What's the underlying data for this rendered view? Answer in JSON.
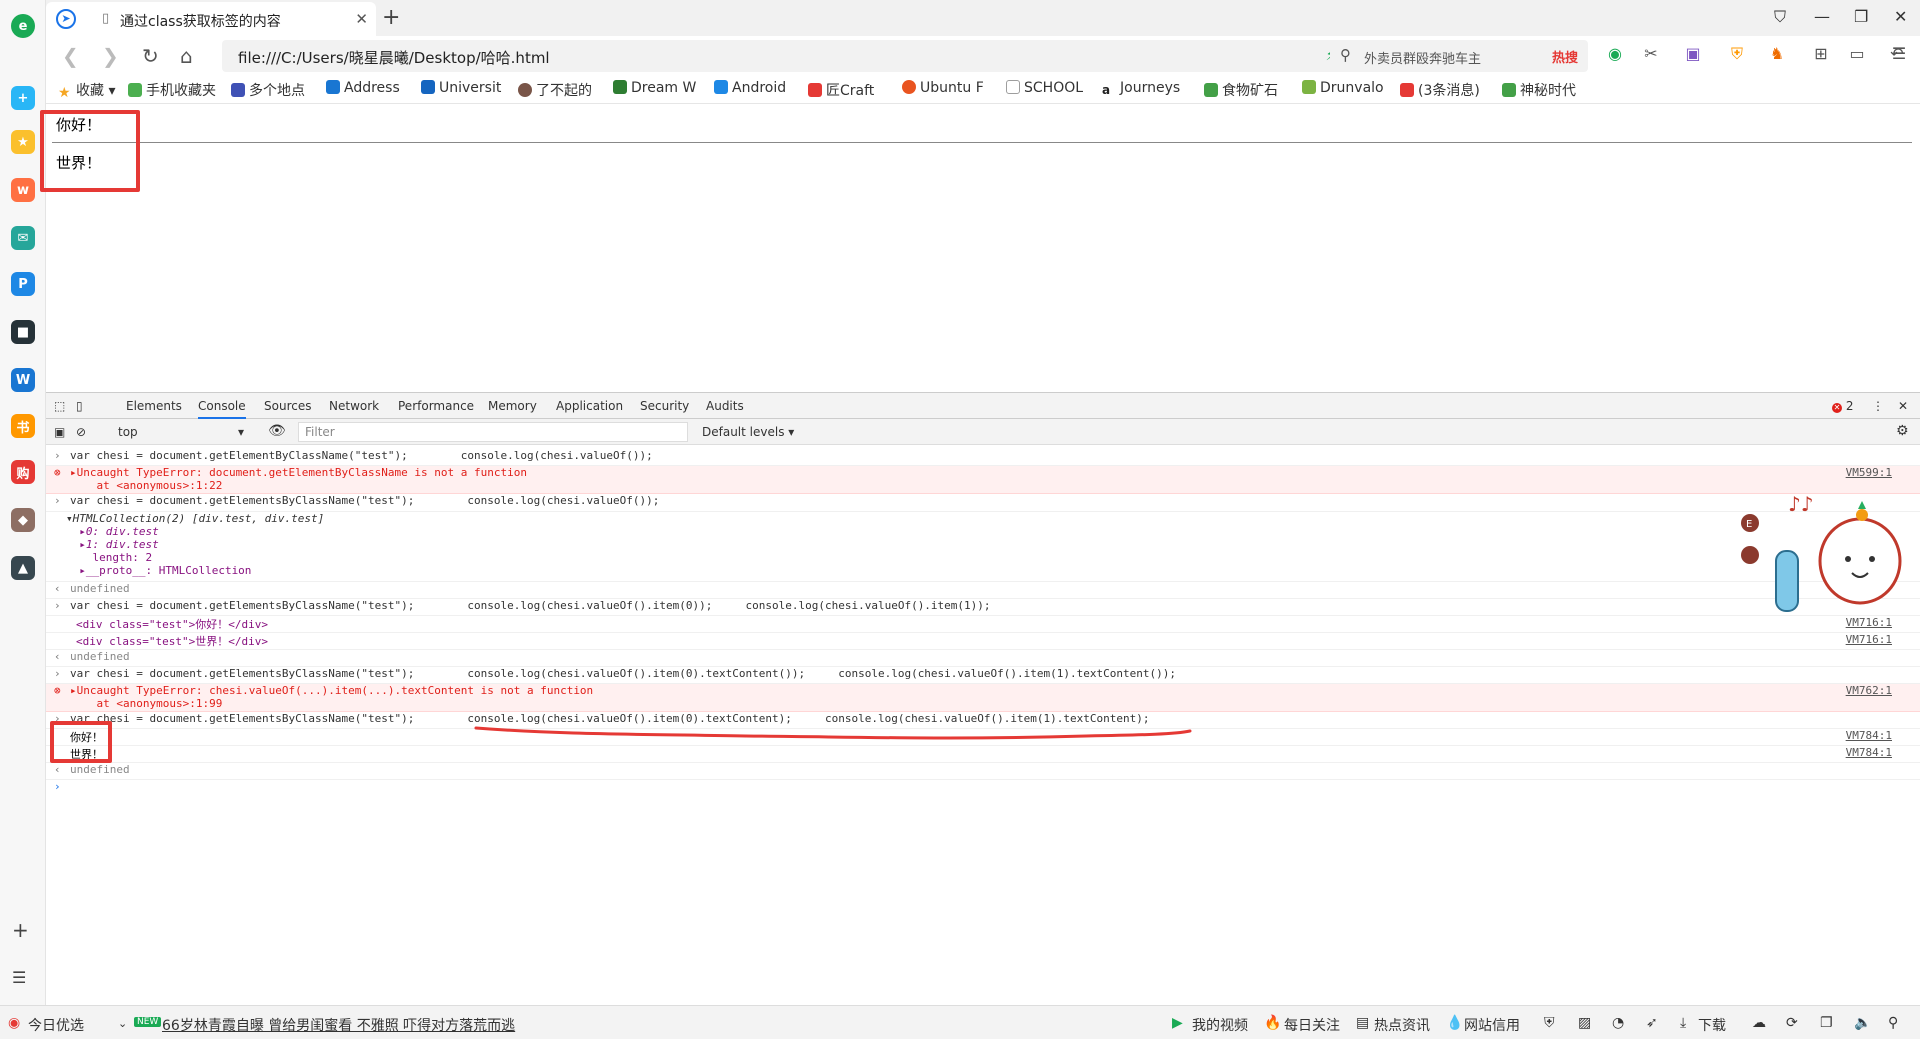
{
  "browser": {
    "tab_title": "通过class获取标签的内容",
    "url": "file:///C:/Users/晓星晨曦/Desktop/哈哈.html",
    "search_placeholder": "外卖员群殴奔驰车主",
    "search_badge": "热搜"
  },
  "bookmarks": [
    {
      "label": "收藏",
      "icon": "star-icon",
      "color": "#f5a623"
    },
    {
      "label": "手机收藏夹",
      "icon": "phone-icon",
      "color": "#4caf50"
    },
    {
      "label": "多个地点",
      "icon": "map-icon",
      "color": "#3f51b5"
    },
    {
      "label": "Address",
      "icon": "address-icon",
      "color": "#1976d2"
    },
    {
      "label": "Universit",
      "icon": "university-icon",
      "color": "#1565c0"
    },
    {
      "label": "了不起的",
      "icon": "gatsby-icon",
      "color": "#795548"
    },
    {
      "label": "Dream W",
      "icon": "dream-icon",
      "color": "#2e7d32"
    },
    {
      "label": "Android",
      "icon": "android-icon",
      "color": "#1e88e5"
    },
    {
      "label": "匠Craft",
      "icon": "craft-icon",
      "color": "#e53935"
    },
    {
      "label": "Ubuntu F",
      "icon": "ubuntu-icon",
      "color": "#e95420"
    },
    {
      "label": "SCHOOL",
      "icon": "page-icon",
      "color": "#9e9e9e"
    },
    {
      "label": "Journeys",
      "icon": "amazon-icon",
      "color": "#222222"
    },
    {
      "label": "食物矿石",
      "icon": "mc-icon",
      "color": "#43a047"
    },
    {
      "label": "Drunvalo",
      "icon": "leaf-icon",
      "color": "#7cb342"
    },
    {
      "label": "(3条消息)",
      "icon": "csdn-icon",
      "color": "#e53935"
    },
    {
      "label": "神秘时代",
      "icon": "mc-icon",
      "color": "#43a047"
    }
  ],
  "page": {
    "line1": "你好！",
    "line2": "世界！"
  },
  "devtools": {
    "tabs": [
      "Elements",
      "Console",
      "Sources",
      "Network",
      "Performance",
      "Memory",
      "Application",
      "Security",
      "Audits"
    ],
    "active_tab": "Console",
    "error_count": "2",
    "context": "top",
    "filter_placeholder": "Filter",
    "levels": "Default levels ▾"
  },
  "console": {
    "r1": "var chesi = document.getElementByClassName(\"test\");        console.log(chesi.valueOf());",
    "r2a": "▸Uncaught TypeError: document.getElementByClassName is not a function",
    "r2b": "    at <anonymous>:1:22",
    "r2src": "VM599:1",
    "r3": "var chesi = document.getElementsByClassName(\"test\");        console.log(chesi.valueOf());",
    "r4a": "▾HTMLCollection(2) [div.test, div.test]",
    "r4b": "  ▸0: div.test",
    "r4c": "  ▸1: div.test",
    "r4d": "    length: 2",
    "r4e": "  ▸__proto__: HTMLCollection",
    "undef": "undefined",
    "r6": "var chesi = document.getElementsByClassName(\"test\");        console.log(chesi.valueOf().item(0));     console.log(chesi.valueOf().item(1));",
    "r7": "<div class=\"test\">你好！</div>",
    "r7src": "VM716:1",
    "r8": "<div class=\"test\">世界！</div>",
    "r8src": "VM716:1",
    "r10": "var chesi = document.getElementsByClassName(\"test\");        console.log(chesi.valueOf().item(0).textContent());     console.log(chesi.valueOf().item(1).textContent());",
    "r11a": "▸Uncaught TypeError: chesi.valueOf(...).item(...).textContent is not a function",
    "r11b": "    at <anonymous>:1:99",
    "r11src": "VM762:1",
    "r12": "var chesi = document.getElementsByClassName(\"test\");        console.log(chesi.valueOf().item(0).textContent);     console.log(chesi.valueOf().item(1).textContent);",
    "r13": "你好！",
    "r13src": "VM784:1",
    "r14": "世界！",
    "r14src": "VM784:1"
  },
  "statusbar": {
    "left": "今日优选",
    "news": "66岁林青霞自曝 曾给男闺蜜看 不雅照 吓得对方落荒而逃",
    "news_badge": "NEW",
    "items": [
      "我的视频",
      "每日关注",
      "热点资讯",
      "网站信用",
      "下载"
    ]
  }
}
